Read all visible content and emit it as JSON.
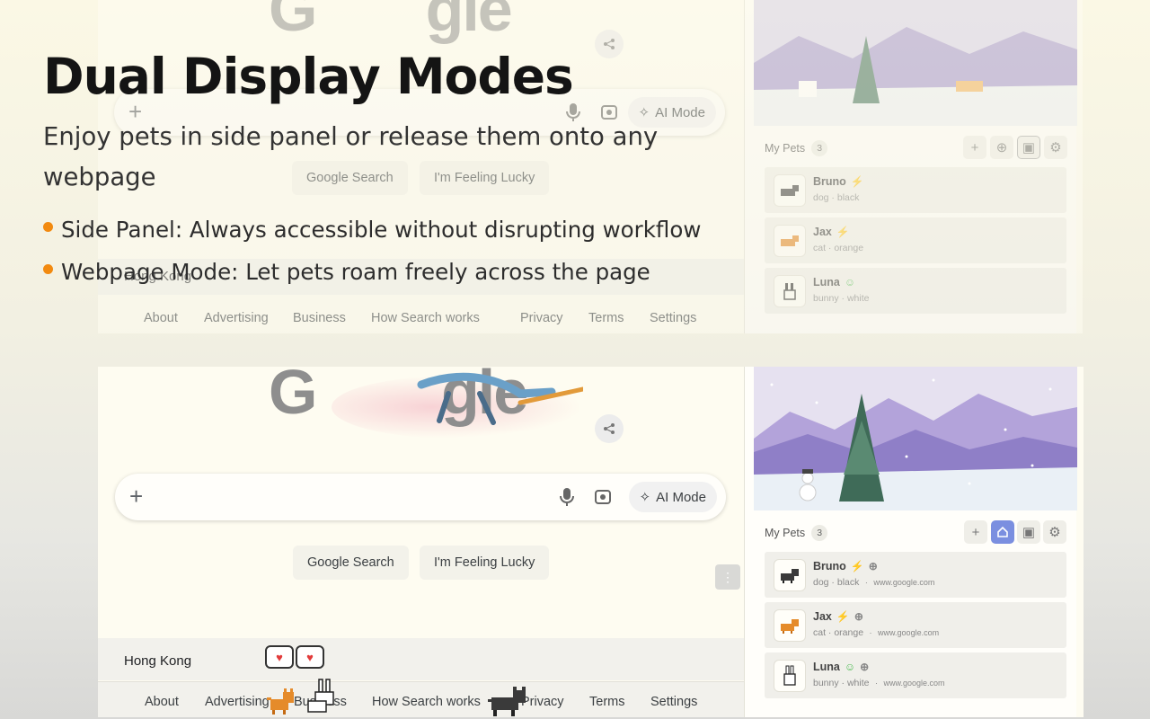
{
  "hero": {
    "title": "Dual Display Modes",
    "subtitle": "Enjoy pets in side panel or release them onto any webpage",
    "bullets": [
      "Side Panel: Always accessible without disrupting workflow",
      "Webpage Mode: Let pets roam freely across the page"
    ],
    "accent_color": "#f28a10"
  },
  "top_shot": {
    "search": {
      "ai_mode": "AI Mode"
    },
    "buttons": {
      "search": "Google Search",
      "lucky": "I'm Feeling Lucky"
    },
    "location": "Hong Kong",
    "footer": [
      "About",
      "Advertising",
      "Business",
      "How Search works",
      "Privacy",
      "Terms",
      "Settings"
    ],
    "panel": {
      "my_pets": "My Pets",
      "count": "3",
      "pets": [
        {
          "name": "Bruno",
          "meta": "dog · black",
          "status": "bolt-icon"
        },
        {
          "name": "Jax",
          "meta": "cat · orange",
          "status": "bolt-icon"
        },
        {
          "name": "Luna",
          "meta": "bunny · white",
          "status": "smile-icon"
        }
      ]
    }
  },
  "bottom_shot": {
    "search": {
      "ai_mode": "AI Mode"
    },
    "buttons": {
      "search": "Google Search",
      "lucky": "I'm Feeling Lucky"
    },
    "location": "Hong Kong",
    "footer": [
      "About",
      "Advertising",
      "Business",
      "How Search works",
      "Privacy",
      "Terms",
      "Settings"
    ],
    "kebab": "⋮",
    "panel": {
      "my_pets": "My Pets",
      "count": "3",
      "pets": [
        {
          "name": "Bruno",
          "meta": "dog · black",
          "site": "www.google.com",
          "status": "bolt-icon"
        },
        {
          "name": "Jax",
          "meta": "cat · orange",
          "site": "www.google.com",
          "status": "bolt-icon"
        },
        {
          "name": "Luna",
          "meta": "bunny · white",
          "site": "www.google.com",
          "status": "smile-icon"
        }
      ],
      "active_tool_color": "#7b8fe0"
    }
  }
}
